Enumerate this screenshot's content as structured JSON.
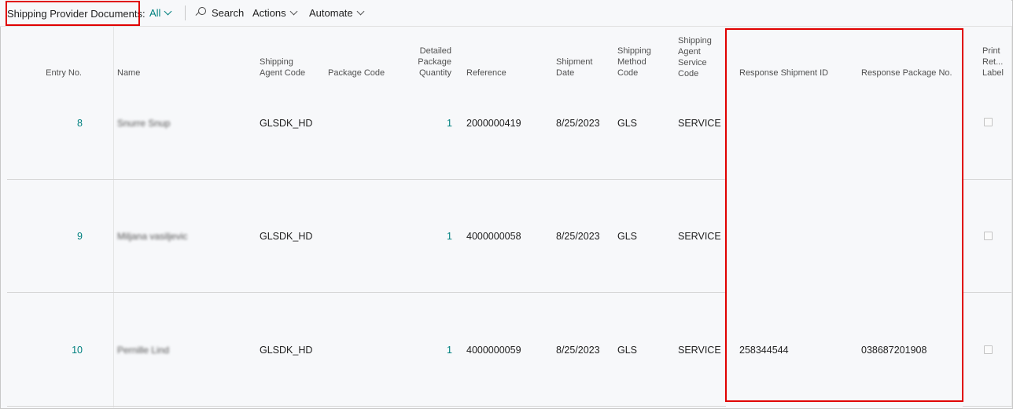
{
  "toolbar": {
    "page_title": "Shipping Provider Documents:",
    "view_filter": "All",
    "search_label": "Search",
    "actions_label": "Actions",
    "automate_label": "Automate"
  },
  "columns": {
    "entry_no": [
      "Entry No."
    ],
    "name": [
      "Name"
    ],
    "shipping_agent_code": [
      "Shipping",
      "Agent Code"
    ],
    "package_code": [
      "Package Code"
    ],
    "detailed_package_quantity": [
      "Detailed",
      "Package",
      "Quantity"
    ],
    "reference": [
      "Reference"
    ],
    "shipment_date": [
      "Shipment",
      "Date"
    ],
    "shipping_method_code": [
      "Shipping",
      "Method",
      "Code"
    ],
    "shipping_agent_service_code": [
      "Shipping",
      "Agent",
      "Service",
      "Code"
    ],
    "response_shipment_id": [
      "Response Shipment ID"
    ],
    "response_package_no": [
      "Response Package No."
    ],
    "print_return_label": [
      "Print",
      "Ret...",
      "Label"
    ]
  },
  "rows": [
    {
      "entry_no": "8",
      "name": "Snurre Snup",
      "shipping_agent_code": "GLSDK_HD",
      "package_code": "",
      "quantity": "1",
      "reference": "2000000419",
      "shipment_date": "8/25/2023",
      "shipping_method_code": "GLS",
      "service_code": "SERVICE",
      "response_shipment_id": "",
      "response_package_no": "",
      "print_return_label": false
    },
    {
      "entry_no": "9",
      "name": "Miljana vasiljevic",
      "shipping_agent_code": "GLSDK_HD",
      "package_code": "",
      "quantity": "1",
      "reference": "4000000058",
      "shipment_date": "8/25/2023",
      "shipping_method_code": "GLS",
      "service_code": "SERVICE",
      "response_shipment_id": "",
      "response_package_no": "",
      "print_return_label": false
    },
    {
      "entry_no": "10",
      "name": "Pernille Lind",
      "shipping_agent_code": "GLSDK_HD",
      "package_code": "",
      "quantity": "1",
      "reference": "4000000059",
      "shipment_date": "8/25/2023",
      "shipping_method_code": "GLS",
      "service_code": "SERVICE",
      "response_shipment_id": "258344544",
      "response_package_no": "038687201908",
      "print_return_label": false
    }
  ],
  "colors": {
    "accent_teal": "#00807f",
    "highlight_red": "#e00000",
    "background": "#f7f8fa"
  }
}
